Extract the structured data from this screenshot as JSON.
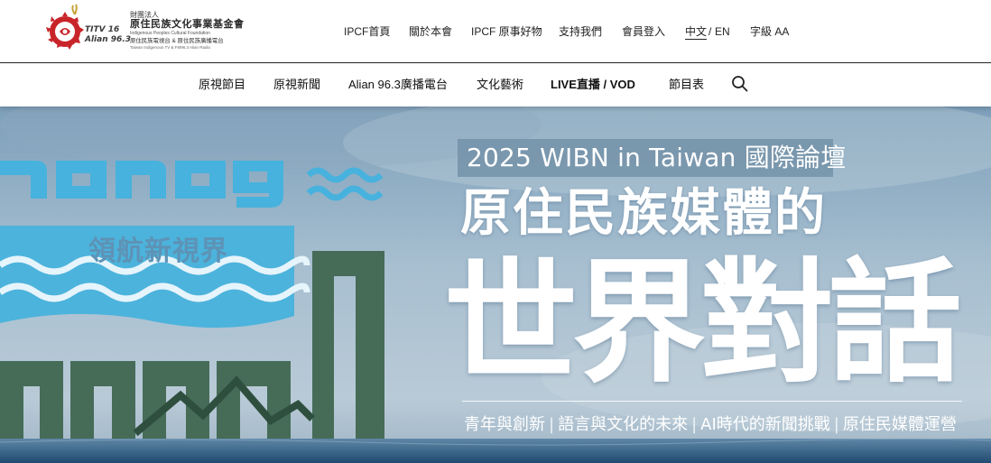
{
  "header": {
    "logo": {
      "sub_line1": "TITV 16",
      "sub_line2": "Alian 96.3",
      "line1": "財團法人",
      "line2": "原住民族文化事業基金會",
      "line3": "Indigenous Peoples Cultural Foundation",
      "line4": "原住民族電視台 & 原住民族廣播電台",
      "line5": "Taiwan Indigenous TV & FM96.3 Alian Radio"
    },
    "top_nav": [
      {
        "label": "IPCF首頁"
      },
      {
        "label": "關於本會"
      },
      {
        "label": "IPCF 原事好物"
      },
      {
        "label": "支持我們"
      },
      {
        "label": "會員登入"
      }
    ],
    "lang": {
      "zh": "中文",
      "sep": "/",
      "en": "EN"
    },
    "font_size": "字級 AA"
  },
  "main_nav": [
    {
      "label": "原視節目"
    },
    {
      "label": "原視新聞"
    },
    {
      "label": "Alian 96.3廣播電台"
    },
    {
      "label": "文化藝術"
    },
    {
      "label": "LIVE直播 / VOD"
    },
    {
      "label": "節目表"
    }
  ],
  "hero": {
    "event_tag": "2025 WIBN in Taiwan 國際論壇",
    "headline1": "原住民族媒體的",
    "headline2": "世界對話",
    "topics": [
      "青年與創新",
      "語言與文化的未來",
      "AI時代的新聞挑戰",
      "原住民媒體運營"
    ],
    "logo_chinese": "領航新視界",
    "colors": {
      "sky": "#9fb9cc",
      "sea": "#2f5e82",
      "logo_blue": "#4cb3dc",
      "logo_green": "#466c58"
    }
  }
}
